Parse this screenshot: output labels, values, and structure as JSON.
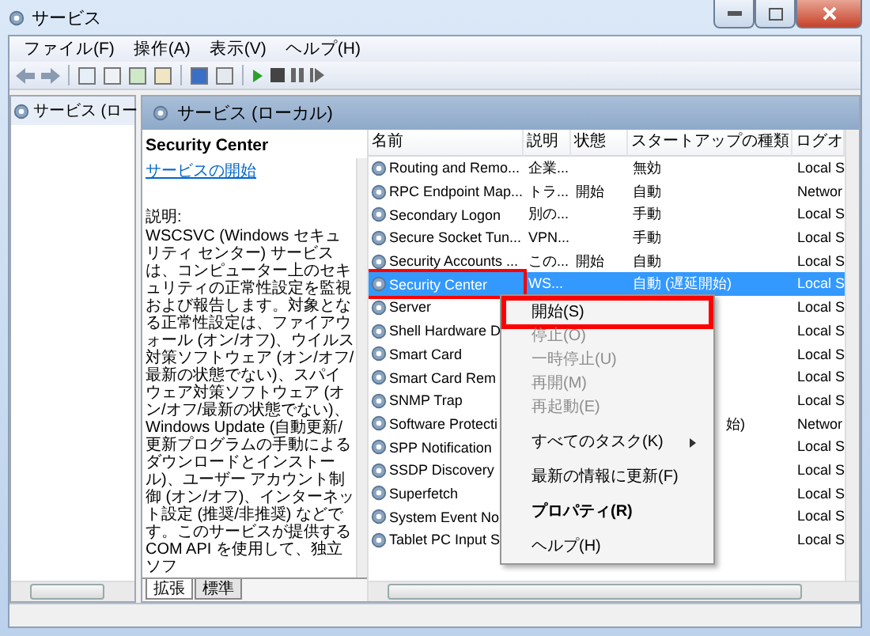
{
  "window": {
    "title": "サービス"
  },
  "menu_bar": [
    "ファイル(F)",
    "操作(A)",
    "表示(V)",
    "ヘルプ(H)"
  ],
  "tree": {
    "items": [
      {
        "label": "サービス (ロー",
        "selected": true
      }
    ]
  },
  "pane_header": {
    "title": "サービス (ローカル)"
  },
  "details": {
    "service_name": "Security Center",
    "link": "サービスの開始",
    "description_label": "説明:",
    "description": "WSCSVC (Windows セキュリティ センター) サービスは、コンピューター上のセキュリティの正常性設定を監視および報告します。対象となる正常性設定は、ファイアウォール (オン/オフ)、ウイルス対策ソフトウェア (オン/オフ/最新の状態でない)、スパイウェア対策ソフトウェア (オン/オフ/最新の状態でない)、Windows Update (自動更新/更新プログラムの手動によるダウンロードとインストール)、ユーザー アカウント制御 (オン/オフ)、インターネット設定 (推奨/非推奨) などです。このサービスが提供する COM API を使用して、独立ソフ"
  },
  "table": {
    "columns": [
      "名前",
      "説明",
      "状態",
      "スタートアップの種類",
      "ログオ"
    ],
    "rows": [
      {
        "name": "Routing and Remo...",
        "description": "企業...",
        "status": "",
        "startup": "無効",
        "logon": "Local S",
        "selected": false,
        "highlighted": false
      },
      {
        "name": "RPC Endpoint Map...",
        "description": "トラ...",
        "status": "開始",
        "startup": "自動",
        "logon": "Networ",
        "selected": false,
        "highlighted": false
      },
      {
        "name": "Secondary Logon",
        "description": "別の...",
        "status": "",
        "startup": "手動",
        "logon": "Local S",
        "selected": false,
        "highlighted": false
      },
      {
        "name": "Secure Socket Tun...",
        "description": "VPN...",
        "status": "",
        "startup": "手動",
        "logon": "Local S",
        "selected": false,
        "highlighted": false
      },
      {
        "name": "Security Accounts ...",
        "description": "この...",
        "status": "開始",
        "startup": "自動",
        "logon": "Local S",
        "selected": false,
        "highlighted": false
      },
      {
        "name": "Security Center",
        "description": "WS...",
        "status": "",
        "startup": "自動 (遅延開始)",
        "logon": "Local S",
        "selected": true,
        "highlighted": true
      },
      {
        "name": "Server",
        "description": "",
        "status": "",
        "startup": "",
        "logon": "Local S",
        "selected": false,
        "highlighted": false
      },
      {
        "name": "Shell Hardware D",
        "description": "",
        "status": "",
        "startup": "",
        "logon": "Local S",
        "selected": false,
        "highlighted": false
      },
      {
        "name": "Smart Card",
        "description": "",
        "status": "",
        "startup": "",
        "logon": "Local S",
        "selected": false,
        "highlighted": false
      },
      {
        "name": "Smart Card Rem",
        "description": "",
        "status": "",
        "startup": "",
        "logon": "Local S",
        "selected": false,
        "highlighted": false
      },
      {
        "name": "SNMP Trap",
        "description": "",
        "status": "",
        "startup": "",
        "logon": "Local S",
        "selected": false,
        "highlighted": false
      },
      {
        "name": "Software Protecti",
        "description": "",
        "status": "",
        "startup": "始)",
        "logon": "Networ",
        "selected": false,
        "highlighted": false
      },
      {
        "name": "SPP Notification",
        "description": "",
        "status": "",
        "startup": "",
        "logon": "Local S",
        "selected": false,
        "highlighted": false
      },
      {
        "name": "SSDP Discovery",
        "description": "",
        "status": "",
        "startup": "",
        "logon": "Local S",
        "selected": false,
        "highlighted": false
      },
      {
        "name": "Superfetch",
        "description": "",
        "status": "",
        "startup": "",
        "logon": "Local S",
        "selected": false,
        "highlighted": false
      },
      {
        "name": "System Event No",
        "description": "",
        "status": "",
        "startup": "",
        "logon": "Local S",
        "selected": false,
        "highlighted": false
      },
      {
        "name": "Tablet PC Input S",
        "description": "",
        "status": "",
        "startup": "",
        "logon": "Local S",
        "selected": false,
        "highlighted": false
      }
    ]
  },
  "bottom_tabs": [
    {
      "label": "拡張",
      "selected": true
    },
    {
      "label": "標準",
      "selected": false
    }
  ],
  "context_menu": {
    "items": [
      {
        "kind": "item",
        "label": "開始(S)",
        "disabled": false,
        "highlighted": true
      },
      {
        "kind": "item",
        "label": "停止(O)",
        "disabled": true
      },
      {
        "kind": "item",
        "label": "一時停止(U)",
        "disabled": true
      },
      {
        "kind": "item",
        "label": "再開(M)",
        "disabled": true
      },
      {
        "kind": "item",
        "label": "再起動(E)",
        "disabled": true
      },
      {
        "kind": "separator"
      },
      {
        "kind": "submenu",
        "label": "すべてのタスク(K)",
        "disabled": false
      },
      {
        "kind": "separator"
      },
      {
        "kind": "item",
        "label": "最新の情報に更新(F)",
        "disabled": false
      },
      {
        "kind": "separator"
      },
      {
        "kind": "bold",
        "label": "プロパティ(R)",
        "disabled": false
      },
      {
        "kind": "separator"
      },
      {
        "kind": "item",
        "label": "ヘルプ(H)",
        "disabled": false
      }
    ]
  }
}
